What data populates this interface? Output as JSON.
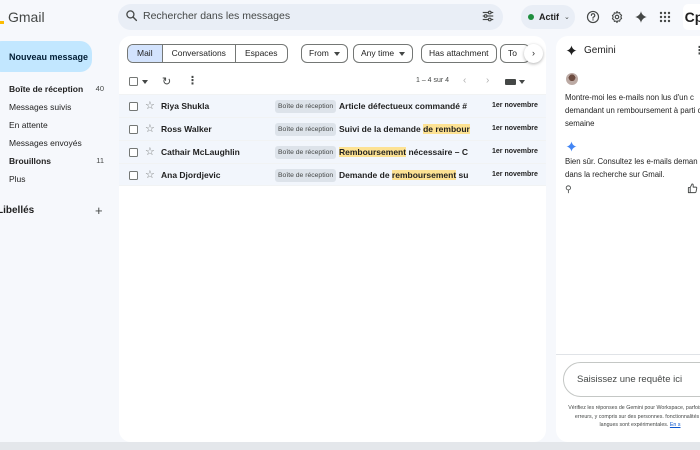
{
  "app": {
    "name": "Gmail"
  },
  "search": {
    "placeholder": "Rechercher dans les messages"
  },
  "header": {
    "status_label": "Actif",
    "account_initial": "Cp"
  },
  "colors": {
    "compose_bg": "#c2e7ff",
    "selected_tab_bg": "#d3e3fd",
    "highlight": "#fde293",
    "status_green": "#1e8e3e",
    "gemini_blue": "#4285f4"
  },
  "sidebar": {
    "compose_label": "Nouveau message",
    "items": [
      {
        "label": "Boîte de réception",
        "count": "40"
      },
      {
        "label": "Messages suivis",
        "count": ""
      },
      {
        "label": "En attente",
        "count": ""
      },
      {
        "label": "Messages envoyés",
        "count": ""
      },
      {
        "label": "Brouillons",
        "count": "11"
      },
      {
        "label": "Plus",
        "count": ""
      }
    ],
    "labels_header": "Libellés"
  },
  "filters": {
    "tabs": [
      "Mail",
      "Conversations",
      "Espaces"
    ],
    "chips": [
      "From",
      "Any time",
      "Has attachment",
      "To"
    ]
  },
  "toolbar": {
    "range": "1 – 4 sur 4"
  },
  "emails": [
    {
      "sender": "Riya Shukla",
      "tag": "Boîte de réception",
      "subject_before": "Article défectueux commandé #",
      "subject_highlight": "",
      "subject_after": "",
      "date": "1er novembre"
    },
    {
      "sender": "Ross Walker",
      "tag": "Boîte de réception",
      "subject_before": "Suivi de la demande ",
      "subject_highlight": "de rembour",
      "subject_after": "",
      "date": "1er novembre"
    },
    {
      "sender": "Cathair McLaughlin",
      "tag": "Boîte de réception",
      "subject_before": "",
      "subject_highlight": "Remboursement",
      "subject_after": " nécessaire – C",
      "date": "1er novembre"
    },
    {
      "sender": "Ana Djordjevic",
      "tag": "Boîte de réception",
      "subject_before": "Demande de ",
      "subject_highlight": "remboursement",
      "subject_after": " su",
      "date": "1er novembre"
    }
  ],
  "gemini": {
    "title": "Gemini",
    "user_message": "Montre-moi les e-mails non lus d'un c demandant un remboursement à parti cette semaine",
    "reply": "Bien sûr. Consultez les e-mails deman dans la recherche sur Gmail.",
    "input_placeholder": "Saisissez une requête ici",
    "disclaimer": "Vérifiez les réponses de Gemini pour Workspace, parfois des erreurs, y compris sur des personnes. fonctionnalités et langues sont expérimentales.",
    "disclaimer_link": "En s"
  }
}
